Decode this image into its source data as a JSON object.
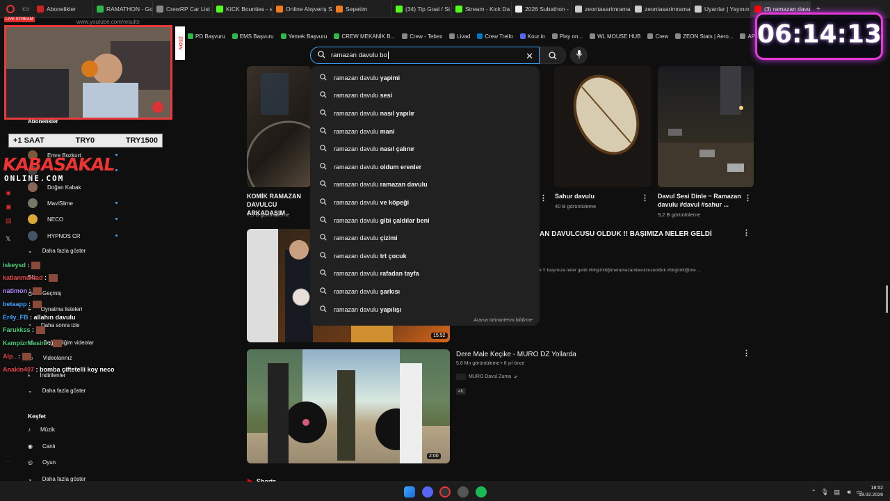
{
  "browser": {
    "address": "www.youtube.com/results",
    "tabs": [
      {
        "label": "Abonelikler",
        "color": "#cc2222"
      },
      {
        "label": "RAMATHON - Go",
        "color": "#2fb84a"
      },
      {
        "label": "CrewRP Car List",
        "color": "#888888"
      },
      {
        "label": "KICK Bounties - e",
        "color": "#53fc18"
      },
      {
        "label": "Online Alışveriş Si",
        "color": "#f27a1a"
      },
      {
        "label": "Sepetim",
        "color": "#f27a1a"
      },
      {
        "label": "(34) Tip Goal / St",
        "color": "#53fc18"
      },
      {
        "label": "Stream - Kick Da",
        "color": "#53fc18"
      },
      {
        "label": "2026 Subathon -",
        "color": "#eeeeee"
      },
      {
        "label": "zeontasarimrama",
        "color": "#cccccc"
      },
      {
        "label": "zeontasarimrama",
        "color": "#cccccc"
      },
      {
        "label": "Uyarılar | Yayının",
        "color": "#cccccc"
      },
      {
        "label": "(3) ramazan davulu - YouT",
        "color": "#ff0000"
      }
    ],
    "bookmarks": [
      {
        "label": "PD Başvuru",
        "color": "#2fb84a"
      },
      {
        "label": "EMS Başvuru",
        "color": "#2fb84a"
      },
      {
        "label": "Yemek Başvuru",
        "color": "#2fb84a"
      },
      {
        "label": "CREW MEKANİK B...",
        "color": "#2fb84a"
      },
      {
        "label": "Crew - Tebex",
        "color": "#888888"
      },
      {
        "label": "Livad",
        "color": "#888888"
      },
      {
        "label": "Crew Trello",
        "color": "#0079bf"
      },
      {
        "label": "Kour.io",
        "color": "#5865f2"
      },
      {
        "label": "Play on...",
        "color": "#888888"
      },
      {
        "label": "WL MOUSE HUB",
        "color": "#888888"
      },
      {
        "label": "Crew",
        "color": "#888888"
      },
      {
        "label": "ZEON Stats | Aero...",
        "color": "#888888"
      },
      {
        "label": "APIq",
        "color": "#888888"
      }
    ]
  },
  "search": {
    "query": "ramazan davulu bo",
    "report_label": "Arama tahminlerini bildirme",
    "prefix": "ramazan davulu",
    "suggestions": [
      "yapimi",
      "sesi",
      "nasıl yapılır",
      "mani",
      "nasıl çalınır",
      "oldum erenler",
      "ramazan davulu",
      "ve köpeği",
      "gibi çaldılar beni",
      "çizimi",
      "trt çocuk",
      "rafadan tayfa",
      "şarkısı",
      "yapılışı"
    ]
  },
  "videos_top": [
    {
      "title": "KOMİK RAMAZAN DAVULCU ARKADAŞIM",
      "views": "7,5 B görüntüleme"
    },
    {
      "title": "Sahur davulu",
      "views": "40 B görüntüleme"
    },
    {
      "title": "Davul Sesi Dinle ~ Ramazan davulu #davul #sahur ...",
      "views": "9,2 B görüntüleme"
    }
  ],
  "video_mid": {
    "title": "AN DAVULCUSU OLDUK !! BAŞIMIZA NELER GELDİ",
    "desc": "k !! başımıza neler geldi #birgünlüğüneramazandavulcusuolduk #birgünlüğüne ...",
    "duration": "15:52"
  },
  "video_bottom": {
    "title": "Dere Male Keçike - MURO DZ Yollarda",
    "meta": "5,6 Mn görüntüleme • 6 yıl önce",
    "channel": "MURO Davul Zuma",
    "badge": "4K",
    "duration": "2:00"
  },
  "shorts_label": "Shorts",
  "sidebar": {
    "subs_header": "Abonelikler",
    "channels": [
      {
        "label": "Emre Bozkurt",
        "color": "#7a5a3a"
      },
      {
        "label": "",
        "color": "#444444"
      },
      {
        "label": "Doğan Kabak",
        "color": "#886655"
      },
      {
        "label": "MaviSlime",
        "color": "#777766"
      },
      {
        "label": "NECO",
        "color": "#d8a838"
      },
      {
        "label": "HYPNOS CR",
        "color": "#445566"
      }
    ],
    "more1": "Daha fazla göster",
    "you_header": "Siz",
    "you_items": [
      "Geçmiş",
      "Oynatma listeleri",
      "Daha sonra izle",
      "Beğendiğim videolar",
      "Videolarınız",
      "İndirilenler"
    ],
    "more2": "Daha fazla göster",
    "explore_header": "Keşfet",
    "explore_items": [
      "Müzik",
      "Canlı",
      "Oyun"
    ],
    "more3": "Daha fazla göster"
  },
  "overlay": {
    "cam_tag": "LIVE STREAM",
    "badge_left": "+1 SAAT",
    "badge_mid": "TRY0",
    "badge_right": "TRY1500",
    "logo_top": "KABASAKAL",
    "logo_bottom": "ONLINE.COM",
    "side_label": "ZEON",
    "timer": "06:14:13",
    "chat": [
      {
        "user": "iskeysd",
        "msg": "",
        "color": "#4ad07a"
      },
      {
        "user": "katlanmaktad",
        "msg": "",
        "color": "#e04848"
      },
      {
        "user": "natimon",
        "msg": "",
        "color": "#b48cff"
      },
      {
        "user": "betaapp",
        "msg": "",
        "color": "#3ea6ff"
      },
      {
        "user": "Er4y_FB",
        "msg": "allahın davulu",
        "color": "#3ea6ff"
      },
      {
        "user": "Farukkss",
        "msg": "",
        "color": "#4ad07a"
      },
      {
        "user": "KampizrMasini",
        "msg": "",
        "color": "#4ad07a"
      },
      {
        "user": "Alp_",
        "msg": "",
        "color": "#e04848"
      },
      {
        "user": "Anakin407",
        "msg": "bomba çiftetelli koy neco",
        "color": "#e04848"
      }
    ]
  },
  "taskbar": {
    "time": "18:52",
    "date": "18.02.2026"
  }
}
